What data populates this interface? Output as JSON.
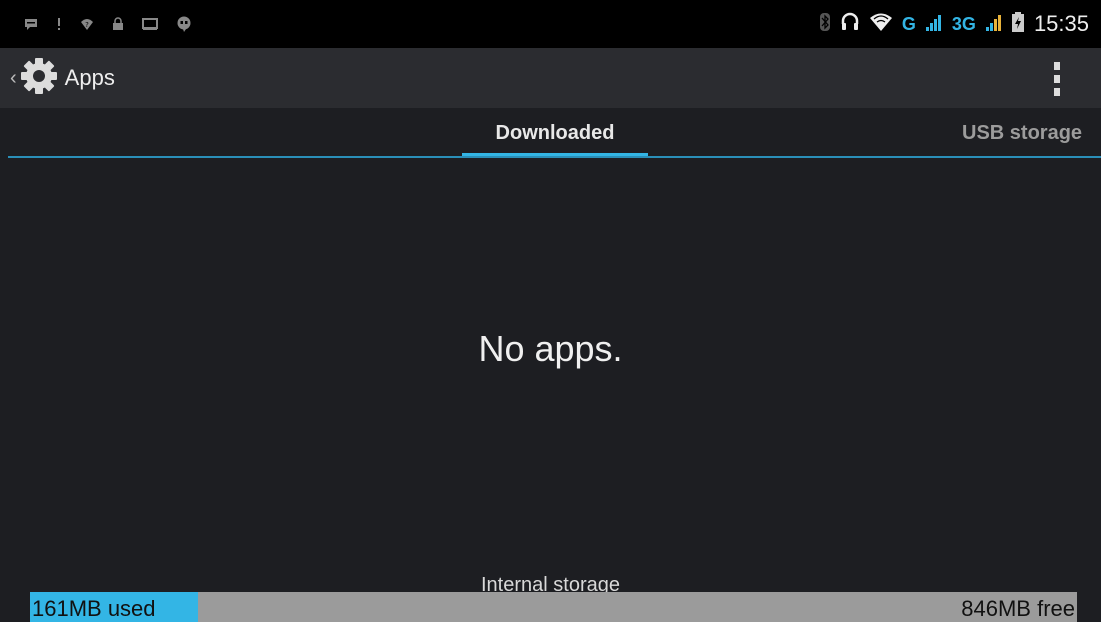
{
  "status_bar": {
    "left_icons": [
      "message-icon",
      "alert-icon",
      "wifi-question-icon",
      "lock-icon",
      "screen-icon",
      "hangouts-icon"
    ],
    "right_icons": [
      "bluetooth-icon",
      "headphones-icon",
      "wifi-icon",
      "signal-icon",
      "battery-icon"
    ],
    "net1": "G",
    "net2": "3G",
    "time": "15:35"
  },
  "action_bar": {
    "title": "Apps",
    "icon": "settings-gear-icon",
    "overflow_icon": "overflow-menu-icon"
  },
  "tabs": [
    {
      "label": "Downloaded",
      "selected": true
    },
    {
      "label": "USB storage",
      "selected": false
    }
  ],
  "main": {
    "empty_message": "No apps."
  },
  "storage": {
    "label": "Internal storage",
    "used": "161MB used",
    "free": "846MB free",
    "used_fraction": 0.16
  },
  "colors": {
    "accent": "#33b5e5",
    "background": "#1d1e22",
    "action_bar": "#2b2c30",
    "status_bar": "#000000"
  }
}
